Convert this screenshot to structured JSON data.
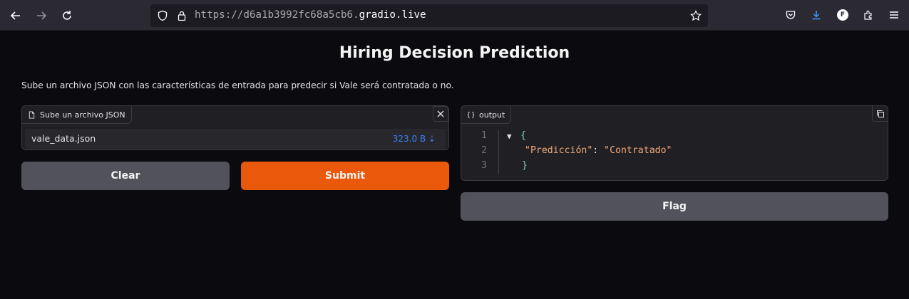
{
  "browser": {
    "url_prefix": "https://",
    "url_host_dim": "d6a1b3992fc68a5cb6.",
    "url_host_hl": "gradio.live",
    "profile_initial": "F"
  },
  "page": {
    "title": "Hiring Decision Prediction",
    "description": "Sube un archivo JSON con las características de entrada para predecir si Vale será contratada o no."
  },
  "input_panel": {
    "label": "Sube un archivo JSON",
    "file_name": "vale_data.json",
    "file_size": "323.0 B ⇣"
  },
  "buttons": {
    "clear": "Clear",
    "submit": "Submit",
    "flag": "Flag"
  },
  "output_panel": {
    "label": "output",
    "lines": [
      {
        "num": "1",
        "arrow": "▼",
        "open": "{"
      },
      {
        "num": "2",
        "key": "\"Predicción\"",
        "colon": ": ",
        "value": "\"Contratado\""
      },
      {
        "num": "3",
        "close": "}"
      }
    ]
  },
  "colors": {
    "background": "#0b0b0f",
    "primary_button": "#ea580c",
    "secondary_button": "#52525b",
    "link_blue": "#3b82f6"
  }
}
